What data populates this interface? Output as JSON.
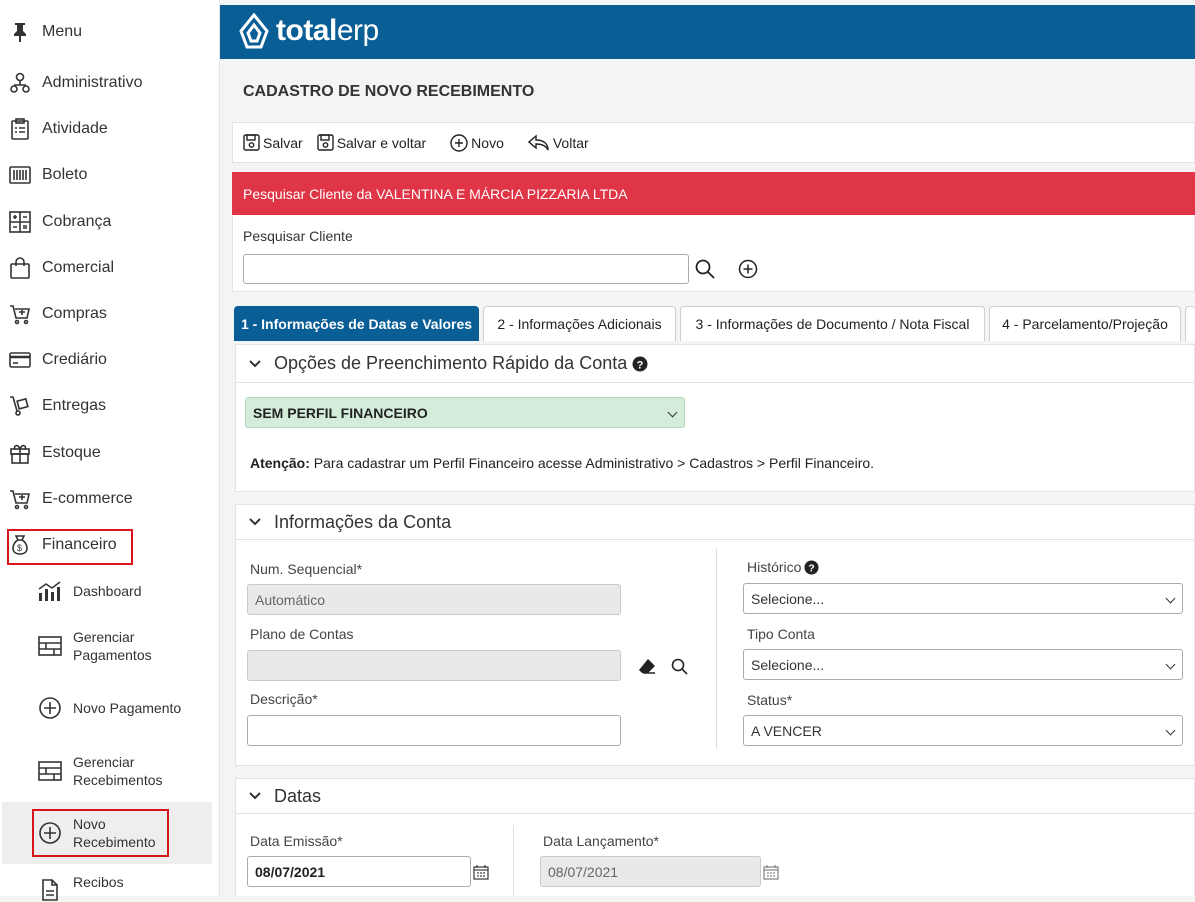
{
  "sidebar": {
    "items": [
      {
        "label": "Menu",
        "icon": "pin-icon"
      },
      {
        "label": "Administrativo",
        "icon": "org-chart-icon"
      },
      {
        "label": "Atividade",
        "icon": "clipboard-icon"
      },
      {
        "label": "Boleto",
        "icon": "barcode-icon"
      },
      {
        "label": "Cobrança",
        "icon": "calculator-icon"
      },
      {
        "label": "Comercial",
        "icon": "shopping-bag-icon"
      },
      {
        "label": "Compras",
        "icon": "cart-icon"
      },
      {
        "label": "Crediário",
        "icon": "credit-card-icon"
      },
      {
        "label": "Entregas",
        "icon": "hand-truck-icon"
      },
      {
        "label": "Estoque",
        "icon": "gift-box-icon"
      },
      {
        "label": "E-commerce",
        "icon": "cart-plus-icon"
      },
      {
        "label": "Financeiro",
        "icon": "money-bag-icon"
      }
    ],
    "sub_items": [
      {
        "label": "Dashboard",
        "icon": "chart-icon"
      },
      {
        "label": "Gerenciar Pagamentos",
        "icon": "list-icon"
      },
      {
        "label": "Novo Pagamento",
        "icon": "plus-circle-icon"
      },
      {
        "label": "Gerenciar Recebimentos",
        "icon": "list-icon"
      },
      {
        "label": "Novo Recebimento",
        "icon": "plus-circle-icon"
      },
      {
        "label": "Recibos",
        "icon": "file-icon"
      }
    ]
  },
  "brand": {
    "part1": "total",
    "part2": "erp"
  },
  "page": {
    "title": "CADASTRO DE NOVO RECEBIMENTO"
  },
  "toolbar": {
    "save": "Salvar",
    "save_back": "Salvar e voltar",
    "new": "Novo",
    "back": "Voltar"
  },
  "alert": {
    "text": "Pesquisar Cliente da VALENTINA E MÁRCIA PIZZARIA LTDA"
  },
  "search": {
    "label": "Pesquisar Cliente",
    "value": ""
  },
  "tabs": [
    "1 - Informações de Datas e Valores",
    "2 - Informações Adicionais",
    "3 - Informações de Documento / Nota Fiscal",
    "4 - Parcelamento/Projeção"
  ],
  "quick_fill": {
    "title": "Opções de Preenchimento Rápido da Conta",
    "profile": "SEM PERFIL FINANCEIRO",
    "notice_bold": "Atenção:",
    "notice_text": " Para cadastrar um Perfil Financeiro acesse Administrativo > Cadastros > Perfil Financeiro."
  },
  "account": {
    "title": "Informações da Conta",
    "seq_label": "Num. Sequencial*",
    "seq_value": "Automático",
    "plan_label": "Plano de Contas",
    "plan_value": "",
    "desc_label": "Descrição*",
    "desc_value": "",
    "history_label": "Histórico",
    "history_value": "Selecione...",
    "type_label": "Tipo Conta",
    "type_value": "Selecione...",
    "status_label": "Status*",
    "status_value": "A VENCER"
  },
  "dates": {
    "title": "Datas",
    "emission_label": "Data Emissão*",
    "emission_value": "08/07/2021",
    "launch_label": "Data Lançamento*",
    "launch_value": "08/07/2021"
  },
  "colors": {
    "topbar": "#0a5e96",
    "alert": "#df3546",
    "highlight": "#d9141b",
    "profile_bg": "#d4edda"
  }
}
